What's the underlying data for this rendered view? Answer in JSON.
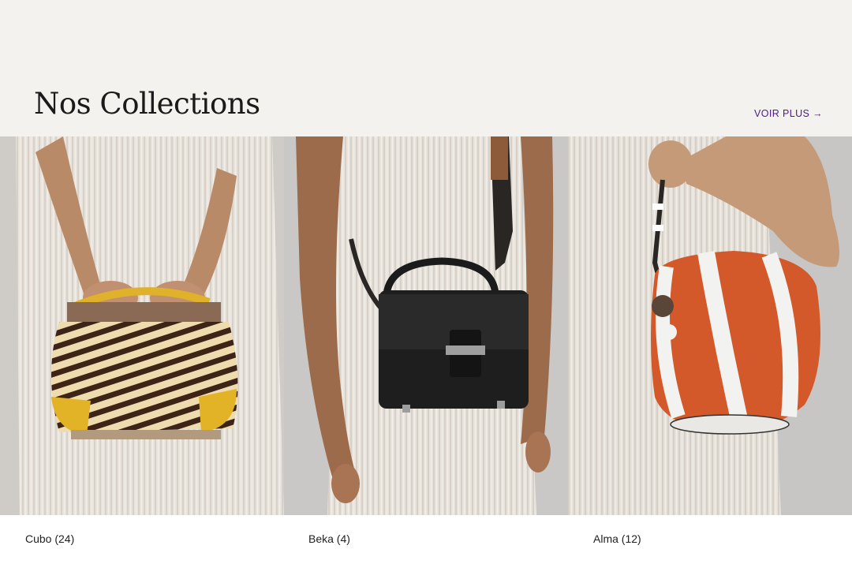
{
  "section": {
    "title": "Nos Collections",
    "link_label": "VOIR PLUS",
    "link_arrow": "→"
  },
  "collections": [
    {
      "caption": "Cubo (24)",
      "image_subject": "zebra-print handbag held by handles"
    },
    {
      "caption": "Beka (4)",
      "image_subject": "black leather crossbody bag"
    },
    {
      "caption": "Alma (12)",
      "image_subject": "orange and white striped bucket bag"
    }
  ],
  "colors": {
    "hero_bg": "#f3f2ef",
    "link": "#4b1a8c",
    "dress": "#e6e1da",
    "backdrop": "#c9c7c4"
  }
}
